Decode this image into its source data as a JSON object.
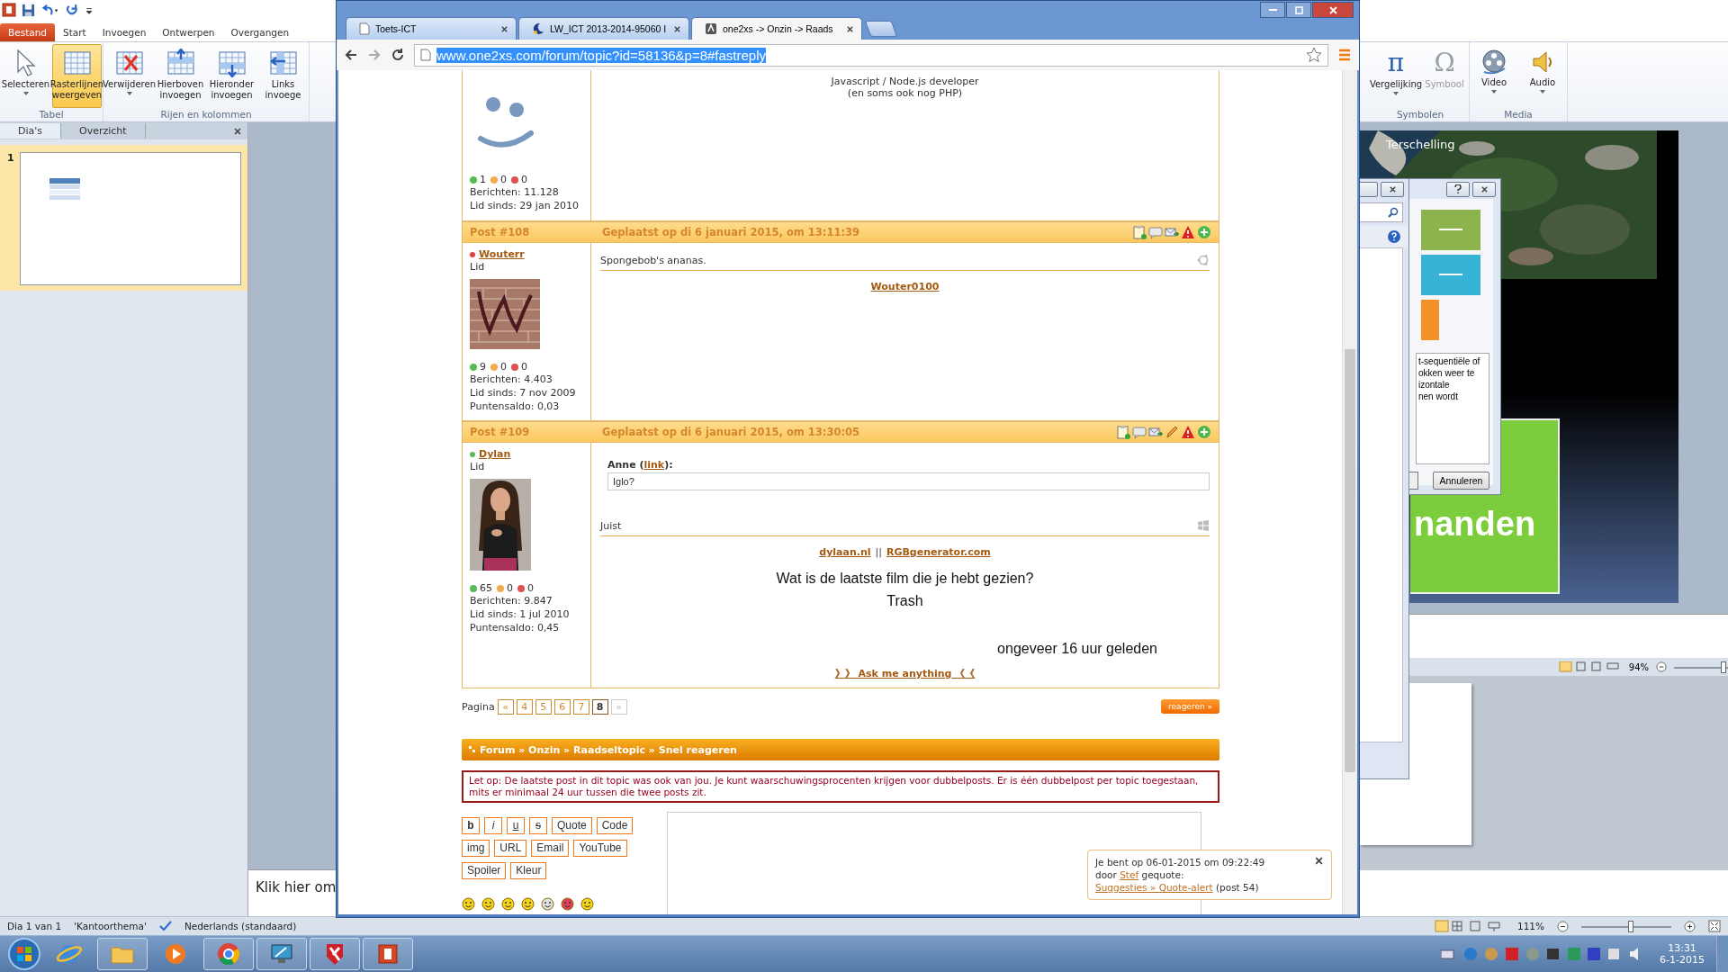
{
  "powerpoint": {
    "ribbon_tabs": [
      {
        "label": "Bestand",
        "selected": true
      },
      {
        "label": "Start",
        "selected": false
      },
      {
        "label": "Invoegen",
        "selected": false
      },
      {
        "label": "Ontwerpen",
        "selected": false
      },
      {
        "label": "Overgangen",
        "selected": false
      }
    ],
    "ribbon_left": [
      {
        "label": "Tabel",
        "buttons": [
          {
            "label": "Selecteren",
            "kind": "cursor",
            "active": false,
            "dropdown": true
          },
          {
            "label": "Rasterlijnen\nweergeven",
            "kind": "grid",
            "active": true,
            "dropdown": false
          }
        ]
      },
      {
        "label": "Rijen en kolommen",
        "buttons": [
          {
            "label": "Verwijderen",
            "kind": "delete",
            "active": false,
            "dropdown": true
          },
          {
            "label": "Hierboven\ninvoegen",
            "kind": "insert-above",
            "active": false,
            "dropdown": false
          },
          {
            "label": "Hieronder\ninvoegen",
            "kind": "insert-below",
            "active": false,
            "dropdown": false
          },
          {
            "label": "Links\ninvoege",
            "kind": "insert-left",
            "active": false,
            "dropdown": false
          }
        ]
      }
    ],
    "ribbon_right": [
      {
        "label": "Symbolen",
        "buttons": [
          {
            "label": "Vergelijking",
            "glyph": "π",
            "disabled": false,
            "dropdown": true
          },
          {
            "label": "Symbool",
            "glyph": "Ω",
            "disabled": true,
            "dropdown": false
          }
        ]
      },
      {
        "label": "Media",
        "buttons": [
          {
            "label": "Video",
            "kind": "film",
            "disabled": false,
            "dropdown": true
          },
          {
            "label": "Audio",
            "kind": "speaker",
            "disabled": false,
            "dropdown": true
          }
        ]
      }
    ],
    "pane_tabs": [
      {
        "label": "Dia's",
        "selected": true
      },
      {
        "label": "Overzicht",
        "selected": false
      }
    ],
    "thumbnail": {
      "number": "1",
      "selected": true
    },
    "slide": {
      "bullet": "Terschelling",
      "heading_fragment": "nanden"
    },
    "dialog": {
      "description_lines": [
        "t-sequentiële of",
        "okken weer te",
        "izontale",
        "nen wordt"
      ],
      "cancel": "Annuleren"
    },
    "second_window": {
      "zoom": "94%",
      "level": 0.92
    },
    "notes": "Klik hier om",
    "status_bar": {
      "slide": "Dia 1 van 1",
      "theme": "'Kantoorthema'",
      "language": "Nederlands (standaard)",
      "zoom": "111%",
      "level": 0.55
    }
  },
  "browser": {
    "tabs": [
      {
        "title": "Toets-ICT",
        "kind": "page",
        "selected": false
      },
      {
        "title": "LW_ICT 2013-2014-95060 I",
        "kind": "moon",
        "selected": false
      },
      {
        "title": "one2xs -> Onzin -> Raads",
        "kind": "site",
        "selected": true
      }
    ],
    "url": "www.one2xs.com/forum/topic?id=58136&p=8#fastreply",
    "url_selected": true
  },
  "forum": {
    "previous_post_tail": {
      "avatar": {
        "kind": "smiley"
      },
      "karma": [
        {
          "color": "#5cb85c",
          "count": "1"
        },
        {
          "color": "#f0ad4e",
          "count": "0"
        },
        {
          "color": "#d9534f",
          "count": "0"
        }
      ],
      "stats": [
        "Berichten: 11.128",
        "Lid sinds: 29 jan 2010"
      ],
      "signature": [
        "Javascript / Node.js developer",
        "(en soms ook nog PHP)"
      ]
    },
    "posts": [
      {
        "number": "Post #108",
        "date": "Geplaatst op di 6 januari 2015, om 13:11:39",
        "actions": [
          {
            "kind": "note"
          },
          {
            "kind": "quote"
          },
          {
            "kind": "forward"
          },
          {
            "kind": "report"
          },
          {
            "kind": "add"
          }
        ],
        "author": "Wouterr",
        "online": false,
        "role": "Lid",
        "avatar": {
          "kind": "picture"
        },
        "karma": [
          {
            "color": "#5cb85c",
            "count": "9"
          },
          {
            "color": "#f0ad4e",
            "count": "0"
          },
          {
            "color": "#d9534f",
            "count": "0"
          }
        ],
        "stats": [
          "Berichten: 4.403",
          "Lid sinds: 7 nov 2009",
          "Puntensaldo: 0,03"
        ],
        "message": "Spongebob's ananas.",
        "platform_icon": {
          "kind": "ring"
        },
        "signature": [
          {
            "kind": "links",
            "items": [
              {
                "kind": "link",
                "text": "Wouter0100"
              }
            ]
          }
        ]
      },
      {
        "number": "Post #109",
        "date": "Geplaatst op di 6 januari 2015, om 13:30:05",
        "actions": [
          {
            "kind": "note"
          },
          {
            "kind": "quote"
          },
          {
            "kind": "forward"
          },
          {
            "kind": "edit"
          },
          {
            "kind": "report"
          },
          {
            "kind": "add"
          }
        ],
        "author": "Dylan",
        "online": true,
        "role": "Lid",
        "avatar": {
          "kind": "picture"
        },
        "karma": [
          {
            "color": "#5cb85c",
            "count": "65"
          },
          {
            "color": "#f0ad4e",
            "count": "0"
          },
          {
            "color": "#d9534f",
            "count": "0"
          }
        ],
        "stats": [
          "Berichten: 9.847",
          "Lid sinds: 1 jul 2010",
          "Puntensaldo: 0,45"
        ],
        "quote": {
          "before": "Anne (",
          "link": "link",
          "after": "):",
          "text": "Iglo?"
        },
        "message": "Juist",
        "platform_icon": {
          "kind": "panes"
        },
        "signature": [
          {
            "kind": "links",
            "items": [
              {
                "kind": "link",
                "text": "dylaan.nl"
              },
              {
                "kind": "separator",
                "text": "||"
              },
              {
                "kind": "link",
                "text": "RGBgenerator.com"
              }
            ]
          },
          {
            "kind": "big",
            "text": "Wat is de laatste film die je hebt gezien?"
          },
          {
            "kind": "big",
            "text": "Trash"
          },
          {
            "kind": "big_right",
            "text": "ongeveer 16 uur geleden"
          },
          {
            "kind": "ask",
            "text": "》》 Ask me anything 《《"
          }
        ]
      }
    ],
    "pagination": {
      "label": "Pagina",
      "pages": [
        {
          "label": "«",
          "selected": false,
          "disabled": false
        },
        {
          "label": "4",
          "selected": false,
          "disabled": false
        },
        {
          "label": "5",
          "selected": false,
          "disabled": false
        },
        {
          "label": "6",
          "selected": false,
          "disabled": false
        },
        {
          "label": "7",
          "selected": false,
          "disabled": false
        },
        {
          "label": "8",
          "selected": true,
          "disabled": false
        },
        {
          "label": "»",
          "selected": false,
          "disabled": true
        }
      ]
    },
    "reply_button": "reageren »",
    "breadcrumb": "Forum » Onzin » Raadseltopic » Snel reageren",
    "warning": "Let op: De laatste post in dit topic was ook van jou. Je kunt waarschuwingsprocenten krijgen voor dubbelposts. Er is één dubbelpost per topic toegestaan, mits er minimaal 24 uur tussen die twee posts zit.",
    "editor_buttons": [
      [
        {
          "label": "b",
          "kind": "bold"
        },
        {
          "label": "i",
          "kind": "italic"
        },
        {
          "label": "u",
          "kind": "underline"
        },
        {
          "label": "s",
          "kind": "strike"
        },
        {
          "label": "Quote",
          "kind": "plain"
        },
        {
          "label": "Code",
          "kind": "plain"
        }
      ],
      [
        {
          "label": "img",
          "kind": "plain"
        },
        {
          "label": "URL",
          "kind": "plain"
        },
        {
          "label": "Email",
          "kind": "plain"
        },
        {
          "label": "YouTube",
          "kind": "plain"
        }
      ],
      [
        {
          "label": "Spoiler",
          "kind": "plain"
        },
        {
          "label": "Kleur",
          "kind": "plain"
        }
      ]
    ],
    "smileys": [
      {
        "color": "#f3d21b"
      },
      {
        "color": "#f3d21b"
      },
      {
        "color": "#f3d21b"
      },
      {
        "color": "#f3d21b"
      },
      {
        "color": "#e0e0e0"
      },
      {
        "color": "#e0405a"
      },
      {
        "color": "#f3d21b"
      }
    ],
    "notification": {
      "before": "Je bent op 06-01-2015 om 09:22:49\ndoor ",
      "user": "Stef",
      "middle": " gequote:\n",
      "topic_link": "Suggesties » Quote-alert",
      "after": " (post 54)"
    }
  },
  "taskbar": {
    "apps": [
      {
        "kind": "globe",
        "running": false
      },
      {
        "kind": "folder",
        "running": true
      },
      {
        "kind": "media",
        "running": false
      },
      {
        "kind": "chrome",
        "running": true
      },
      {
        "kind": "monitor",
        "running": true
      },
      {
        "kind": "shield",
        "running": true
      },
      {
        "kind": "slides",
        "running": true
      }
    ],
    "time": "13:31",
    "date": "6-1-2015"
  }
}
